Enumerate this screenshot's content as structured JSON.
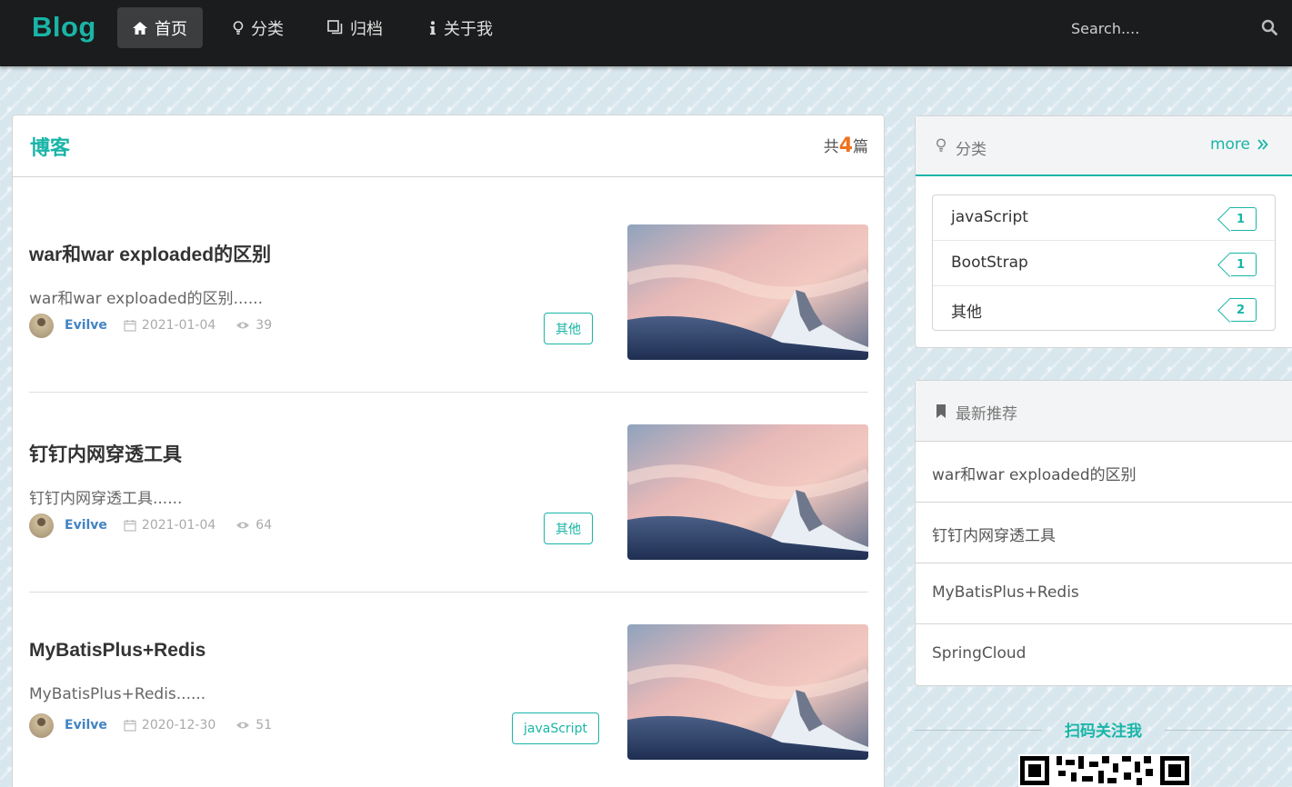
{
  "nav": {
    "brand": "Blog",
    "items": [
      {
        "label": "首页",
        "icon": "home-icon",
        "active": true
      },
      {
        "label": "分类",
        "icon": "lightbulb-icon",
        "active": false
      },
      {
        "label": "归档",
        "icon": "clone-icon",
        "active": false
      },
      {
        "label": "关于我",
        "icon": "info-icon",
        "active": false
      }
    ],
    "search_placeholder": "Search...."
  },
  "main": {
    "title": "博客",
    "count_prefix": "共",
    "count": "4",
    "count_suffix": "篇",
    "posts": [
      {
        "title": "war和war exploaded的区别",
        "desc": "war和war exploaded的区别......",
        "author": "Evilve",
        "date": "2021-01-04",
        "views": "39",
        "tag": "其他"
      },
      {
        "title": "钉钉内网穿透工具",
        "desc": "钉钉内网穿透工具......",
        "author": "Evilve",
        "date": "2021-01-04",
        "views": "64",
        "tag": "其他"
      },
      {
        "title": "MyBatisPlus+Redis",
        "desc": "MyBatisPlus+Redis......",
        "author": "Evilve",
        "date": "2020-12-30",
        "views": "51",
        "tag": "javaScript"
      }
    ]
  },
  "sidebar": {
    "categories": {
      "title": "分类",
      "more": "more",
      "items": [
        {
          "name": "javaScript",
          "count": "1"
        },
        {
          "name": "BootStrap",
          "count": "1"
        },
        {
          "name": "其他",
          "count": "2"
        }
      ]
    },
    "recommend": {
      "title": "最新推荐",
      "items": [
        "war和war exploaded的区别",
        "钉钉内网穿透工具",
        "MyBatisPlus+Redis",
        "SpringCloud"
      ]
    },
    "qr": {
      "title": "扫码关注我"
    }
  },
  "colors": {
    "accent": "#19b5a7",
    "nav_bg": "#1b1c1d",
    "link": "#4183c4",
    "count": "#f2711c"
  }
}
